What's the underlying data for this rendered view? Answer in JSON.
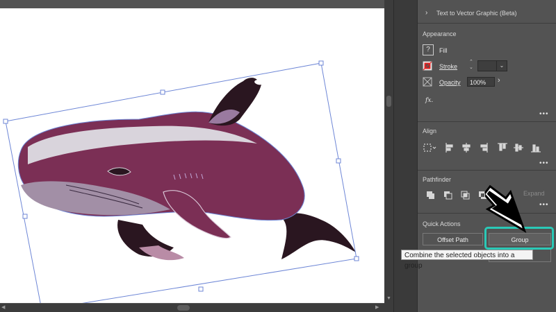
{
  "panel": {
    "text_to_vector": "Text to Vector Graphic (Beta)",
    "appearance": {
      "title": "Appearance",
      "fill_label": "Fill",
      "stroke_label": "Stroke",
      "opacity_label": "Opacity",
      "opacity_value": "100%",
      "fx_label": "fx."
    },
    "align": {
      "title": "Align"
    },
    "pathfinder": {
      "title": "Pathfinder",
      "expand_label": "Expand"
    },
    "quick_actions": {
      "title": "Quick Actions",
      "offset_path_label": "Offset Path",
      "group_label": "Group"
    },
    "more_label": "•••"
  },
  "tooltip": {
    "text": "Combine the selected objects into a group"
  },
  "colors": {
    "highlight": "#2ac9b7",
    "whale_body": "#7b2f55",
    "whale_dark": "#2a1620",
    "selection": "#6d86d6"
  },
  "icons": [
    "chevron-right-icon",
    "question-icon",
    "stroke-swatch-icon",
    "opacity-icon",
    "fx-icon",
    "align-icons",
    "pathfinder-icons",
    "cursor-arrow-icon"
  ]
}
